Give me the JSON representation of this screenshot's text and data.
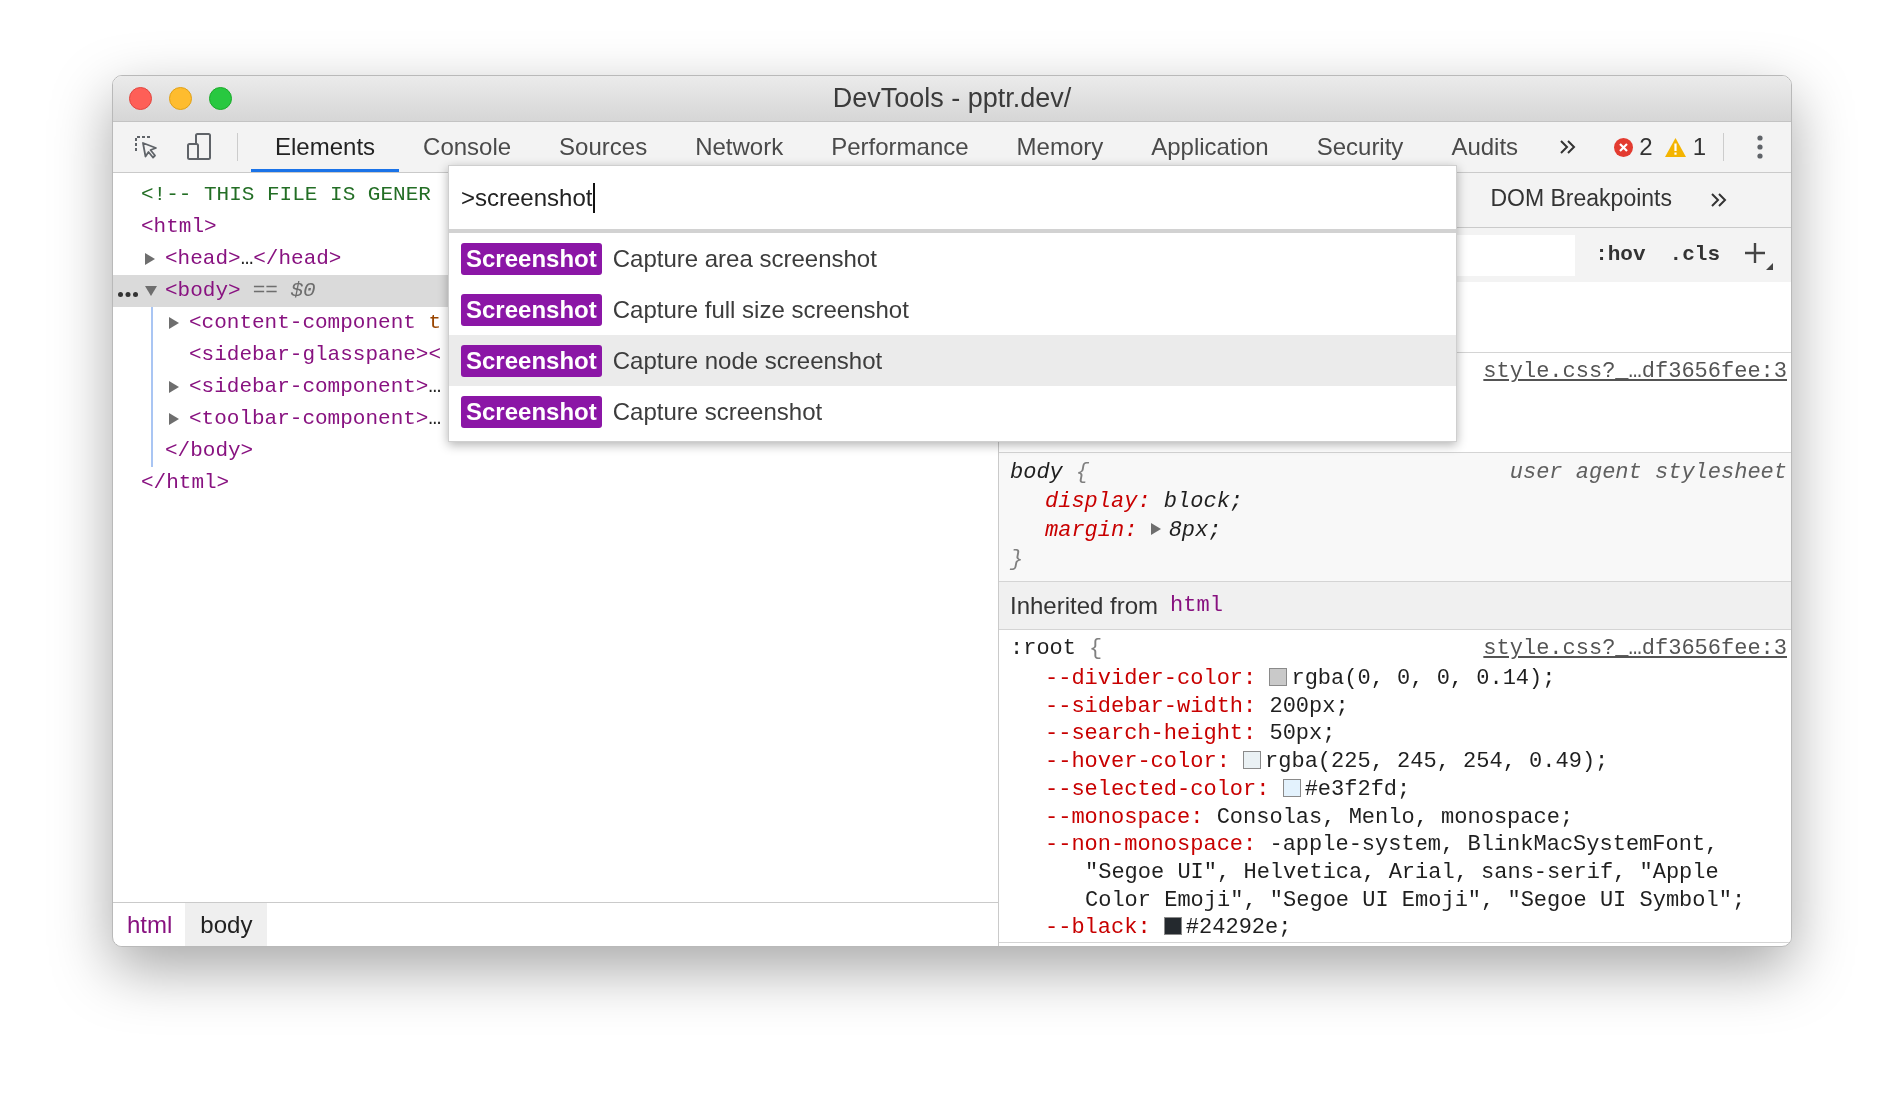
{
  "window": {
    "title": "DevTools - pptr.dev/"
  },
  "toolbar": {
    "tabs": [
      {
        "label": "Elements",
        "selected": true
      },
      {
        "label": "Console",
        "selected": false
      },
      {
        "label": "Sources",
        "selected": false
      },
      {
        "label": "Network",
        "selected": false
      },
      {
        "label": "Performance",
        "selected": false
      },
      {
        "label": "Memory",
        "selected": false
      },
      {
        "label": "Application",
        "selected": false
      },
      {
        "label": "Security",
        "selected": false
      },
      {
        "label": "Audits",
        "selected": false
      }
    ],
    "error_count": "2",
    "warning_count": "1"
  },
  "elements_tree": [
    {
      "kind": "comment",
      "text": "<!-- THIS FILE IS GENER",
      "selected": false
    },
    {
      "kind": "element",
      "tag": "<html>",
      "selected": false,
      "close_tag": "</html>",
      "children": [
        {
          "kind": "element",
          "tag": "<head>",
          "ellipsis": "…",
          "close_tag": "</head>",
          "expanded": false,
          "selected": false
        },
        {
          "kind": "element",
          "tag": "<body>",
          "marker": "== *$0*",
          "expanded": true,
          "selected": true,
          "close_tag": "</body>",
          "children": [
            {
              "kind": "element",
              "tag": "<content-component",
              "attribute": "t",
              "expanded": false,
              "selected": false
            },
            {
              "kind": "element",
              "tag": "<sidebar-glasspane>",
              "close_tag": "<",
              "selected": false
            },
            {
              "kind": "element",
              "tag": "<sidebar-component>",
              "ellipsis": "…",
              "expanded": false,
              "selected": false
            },
            {
              "kind": "element",
              "tag": "<toolbar-component>",
              "ellipsis": "…",
              "expanded": false,
              "selected": false
            }
          ]
        }
      ]
    }
  ],
  "breadcrumbs": [
    {
      "label": "html",
      "selected": false
    },
    {
      "label": "body",
      "selected": true
    }
  ],
  "styles_pane": {
    "tabs": [
      {
        "label": "DOM Breakpoints",
        "selected": false
      }
    ],
    "filter_buttons": [
      ":hov",
      ".cls"
    ],
    "sections": [
      {
        "kind": "author",
        "source": "style.css?_…df3656fee:3"
      },
      {
        "kind": "user_agent",
        "selector": "body",
        "open_brace": "{",
        "source": "user agent stylesheet",
        "declarations": [
          {
            "name": "display:",
            "value": "block;"
          },
          {
            "name": "margin:",
            "value": "8px;",
            "expanded": false
          }
        ],
        "close_brace": "}"
      },
      {
        "kind": "inherited",
        "label": "Inherited from",
        "element": "html"
      },
      {
        "kind": "author",
        "selector": ":root",
        "open_brace": "{",
        "source": "style.css?_…df3656fee:3",
        "declarations": [
          {
            "name": "--divider-color:",
            "color": "#c9c9c9",
            "value": "rgba(0, 0, 0, 0.14);"
          },
          {
            "name": "--sidebar-width:",
            "value": "200px;"
          },
          {
            "name": "--search-height:",
            "value": "50px;"
          },
          {
            "name": "--hover-color:",
            "color": "#eaf1f4",
            "value": "rgba(225, 245, 254, 0.49);"
          },
          {
            "name": "--selected-color:",
            "color": "#e3f2fd",
            "value": "#e3f2fd;"
          },
          {
            "name": "--monospace:",
            "value": "Consolas, Menlo, monospace;"
          },
          {
            "name": "--non-monospace:",
            "value": "-apple-system, BlinkMacSystemFont, \"Segoe UI\", Helvetica, Arial, sans-serif, \"Apple Color Emoji\", \"Segoe UI Emoji\", \"Segoe UI Symbol\";"
          },
          {
            "name": "--black:",
            "color": "#24292e",
            "value": "#24292e;"
          }
        ]
      }
    ]
  },
  "command_menu": {
    "query": ">screenshot",
    "items": [
      {
        "category": "Screenshot",
        "label": "Capture area screenshot",
        "selected": false
      },
      {
        "category": "Screenshot",
        "label": "Capture full size screenshot",
        "selected": false
      },
      {
        "category": "Screenshot",
        "label": "Capture node screenshot",
        "selected": true
      },
      {
        "category": "Screenshot",
        "label": "Capture screenshot",
        "selected": false
      }
    ]
  }
}
